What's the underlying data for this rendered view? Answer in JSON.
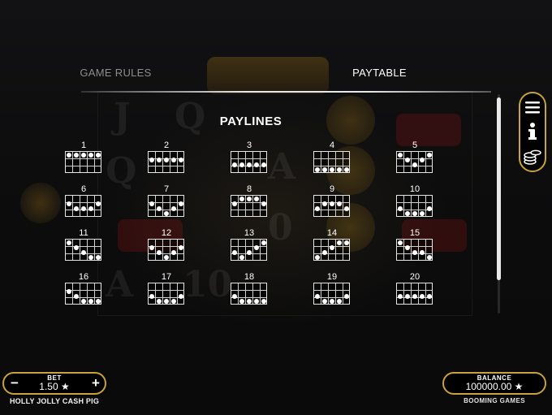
{
  "tabs": {
    "game_rules": "GAME RULES",
    "paytable": "PAYTABLE"
  },
  "heading": "PAYLINES",
  "paylines": [
    {
      "number": "1",
      "rows": [
        0,
        0,
        0,
        0,
        0
      ]
    },
    {
      "number": "2",
      "rows": [
        1,
        1,
        1,
        1,
        1
      ]
    },
    {
      "number": "3",
      "rows": [
        2,
        2,
        2,
        2,
        2
      ]
    },
    {
      "number": "4",
      "rows": [
        3,
        3,
        3,
        3,
        3
      ]
    },
    {
      "number": "5",
      "rows": [
        0,
        1,
        2,
        1,
        0
      ]
    },
    {
      "number": "6",
      "rows": [
        1,
        2,
        2,
        2,
        1
      ]
    },
    {
      "number": "7",
      "rows": [
        1,
        2,
        3,
        2,
        1
      ]
    },
    {
      "number": "8",
      "rows": [
        1,
        0,
        0,
        0,
        1
      ]
    },
    {
      "number": "9",
      "rows": [
        2,
        1,
        1,
        1,
        2
      ]
    },
    {
      "number": "10",
      "rows": [
        2,
        3,
        3,
        3,
        2
      ]
    },
    {
      "number": "11",
      "rows": [
        0,
        1,
        2,
        3,
        3
      ]
    },
    {
      "number": "12",
      "rows": [
        1,
        2,
        3,
        2,
        1
      ]
    },
    {
      "number": "13",
      "rows": [
        2,
        3,
        2,
        1,
        0
      ]
    },
    {
      "number": "14",
      "rows": [
        3,
        2,
        1,
        0,
        0
      ]
    },
    {
      "number": "15",
      "rows": [
        0,
        1,
        2,
        2,
        3
      ]
    },
    {
      "number": "16",
      "rows": [
        1,
        2,
        3,
        3,
        3
      ]
    },
    {
      "number": "17",
      "rows": [
        2,
        3,
        3,
        3,
        2
      ]
    },
    {
      "number": "18",
      "rows": [
        2,
        3,
        3,
        3,
        3
      ]
    },
    {
      "number": "19",
      "rows": [
        2,
        3,
        3,
        3,
        2
      ]
    },
    {
      "number": "20",
      "rows": [
        2,
        2,
        2,
        2,
        2
      ]
    }
  ],
  "bet": {
    "label": "BET",
    "value": "1.50 ★",
    "minus": "−",
    "plus": "+"
  },
  "balance": {
    "label": "BALANCE",
    "value": "100000.00 ★"
  },
  "game_name": "HOLLY JOLLY CASH PIG",
  "brand": "BOOMING GAMES",
  "side_menu": {
    "icons": [
      "menu-icon",
      "info-icon",
      "coins-icon"
    ]
  },
  "colors": {
    "gold_border": "#c9a13f",
    "text": "#ffffff",
    "inactive_tab": "#8d8d8d"
  }
}
